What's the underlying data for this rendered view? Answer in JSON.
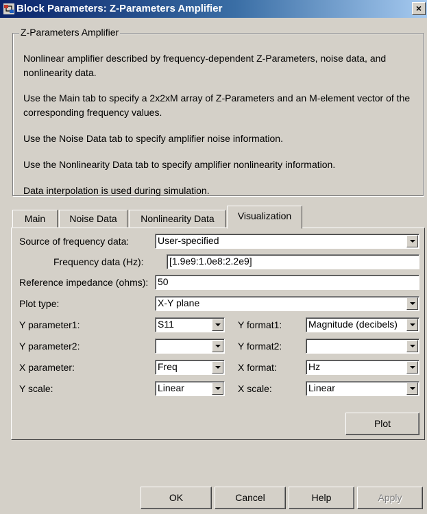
{
  "window": {
    "title": "Block Parameters: Z-Parameters Amplifier",
    "close_label": "×"
  },
  "group": {
    "title": "Z-Parameters Amplifier",
    "descriptions": [
      "Nonlinear amplifier described by frequency-dependent Z-Parameters, noise data, and nonlinearity data.",
      "Use the Main tab to specify a 2x2xM array of Z-Parameters and an M-element vector of the corresponding frequency values.",
      "Use the Noise Data tab to specify amplifier noise information.",
      "Use the Nonlinearity Data tab to specify amplifier nonlinearity information.",
      "Data interpolation is used during simulation."
    ]
  },
  "tabs": [
    {
      "label": "Main"
    },
    {
      "label": "Noise Data"
    },
    {
      "label": "Nonlinearity Data"
    },
    {
      "label": "Visualization",
      "active": true
    }
  ],
  "form": {
    "source_label": "Source of frequency data:",
    "source_value": "User-specified",
    "freq_label": "Frequency data (Hz):",
    "freq_value": "[1.9e9:1.0e8:2.2e9]",
    "refimp_label": "Reference impedance (ohms):",
    "refimp_value": "50",
    "plottype_label": "Plot type:",
    "plottype_value": "X-Y plane",
    "yparam1_label": "Y parameter1:",
    "yparam1_value": "S11",
    "yformat1_label": "Y format1:",
    "yformat1_value": "Magnitude (decibels)",
    "yparam2_label": "Y parameter2:",
    "yparam2_value": "",
    "yformat2_label": "Y format2:",
    "yformat2_value": "",
    "xparam_label": "X parameter:",
    "xparam_value": "Freq",
    "xformat_label": "X format:",
    "xformat_value": "Hz",
    "yscale_label": "Y scale:",
    "yscale_value": "Linear",
    "xscale_label": "X scale:",
    "xscale_value": "Linear",
    "plot_button": "Plot"
  },
  "buttons": {
    "ok": "OK",
    "cancel": "Cancel",
    "help": "Help",
    "apply": "Apply"
  }
}
